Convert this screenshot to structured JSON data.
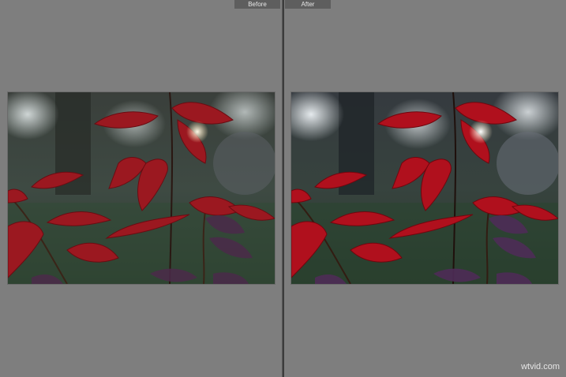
{
  "compare": {
    "before_label": "Before",
    "after_label": "After"
  },
  "watermark": "wtvid.com",
  "colors": {
    "background": "#7f7f7f",
    "divider": "#3c3c3c",
    "leaf_before": "#9b1820",
    "leaf_after": "#b0101d"
  }
}
